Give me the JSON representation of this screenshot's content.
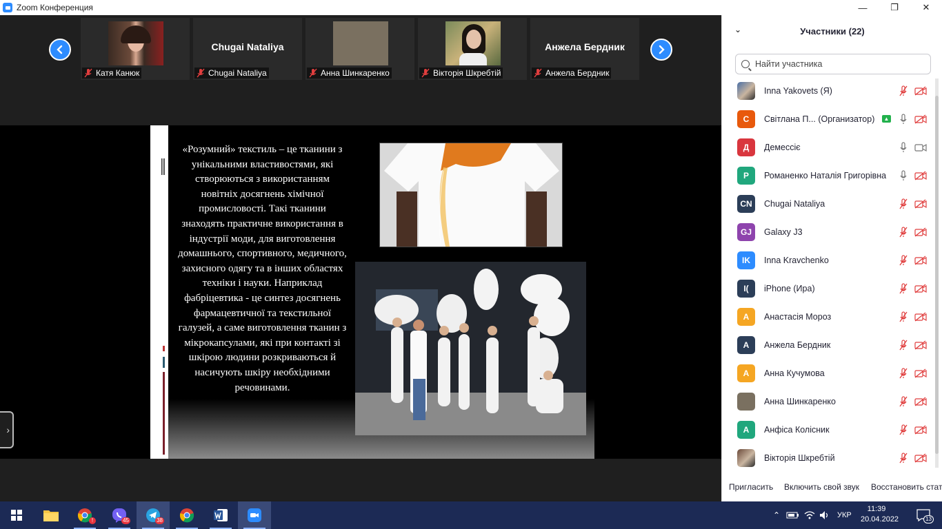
{
  "window": {
    "title": "Zoom Конференция"
  },
  "thumbnails": [
    {
      "name": "Катя Канюк",
      "has_photo": true
    },
    {
      "name": "Chugai Nataliya",
      "big_name": "Chugai Nataliya",
      "has_photo": false
    },
    {
      "name": "Анна Шинкаренко",
      "has_photo": true
    },
    {
      "name": "Вікторія Шкребтій",
      "has_photo": true
    },
    {
      "name": "Анжела Бердник",
      "big_name": "Анжела Бердник",
      "has_photo": false
    }
  ],
  "slide": {
    "text": "«Розумний» текстиль – це тканини з унікальними властивостями, які створюються з використанням новітніх досягнень хімічної промисловості. Такі тканини знаходять практичне використання в індустрії моди, для виготовлення домашнього, спортивного, медичного, захисного одягу та в інших областях техніки і науки. Наприклад фабріцевтика - це синтез досягнень фармацевтичної та текстильної галузей, а саме виготовлення тканин з мікрокапсулами, які при контакті зі шкірою людини розкриваються й насичують шкіру необхідними речовинами."
  },
  "participants_panel": {
    "title": "Участники (22)",
    "search_placeholder": "Найти участника",
    "participants": [
      {
        "name": "Inna Yakovets  (Я)",
        "initials": "",
        "color": "#4a6fa5",
        "photo": true,
        "mic": "muted",
        "cam": "off"
      },
      {
        "name": "Світлана П...   (Организатор)",
        "initials": "С",
        "color": "#e8590c",
        "photo": false,
        "mic": "on",
        "cam": "off",
        "share_badge": true
      },
      {
        "name": "Демессіє",
        "initials": "Д",
        "color": "#d9363e",
        "photo": false,
        "mic": "on",
        "cam": "on"
      },
      {
        "name": "Романенко Наталія Григорівна",
        "initials": "Р",
        "color": "#20a77d",
        "photo": false,
        "mic": "on",
        "cam": "off"
      },
      {
        "name": "Chugai Nataliya",
        "initials": "CN",
        "color": "#2c3e58",
        "photo": false,
        "mic": "muted",
        "cam": "off"
      },
      {
        "name": "Galaxy J3",
        "initials": "GJ",
        "color": "#8e44ad",
        "photo": false,
        "mic": "muted",
        "cam": "off"
      },
      {
        "name": "Inna Kravchenko",
        "initials": "IK",
        "color": "#2d8cff",
        "photo": false,
        "mic": "muted",
        "cam": "off"
      },
      {
        "name": "iPhone (Ира)",
        "initials": "I(",
        "color": "#2c3e58",
        "photo": false,
        "mic": "muted",
        "cam": "off"
      },
      {
        "name": "Анастасія Мороз",
        "initials": "А",
        "color": "#f5a623",
        "photo": false,
        "mic": "muted",
        "cam": "off"
      },
      {
        "name": "Анжела Бердник",
        "initials": "А",
        "color": "#2c3e58",
        "photo": false,
        "mic": "muted",
        "cam": "off"
      },
      {
        "name": "Анна Кучумова",
        "initials": "А",
        "color": "#f5a623",
        "photo": false,
        "mic": "muted",
        "cam": "off"
      },
      {
        "name": "Анна Шинкаренко",
        "initials": "",
        "color": "#7a7060",
        "photo": false,
        "mic": "muted",
        "cam": "off"
      },
      {
        "name": "Анфіса Колісник",
        "initials": "А",
        "color": "#20a77d",
        "photo": false,
        "mic": "muted",
        "cam": "off"
      },
      {
        "name": "Вікторія Шкребтій",
        "initials": "",
        "color": "#6b4a3a",
        "photo": true,
        "mic": "muted",
        "cam": "off"
      }
    ],
    "footer": {
      "invite": "Пригласить",
      "unmute": "Включить свой звук",
      "restore": "Восстановить стату"
    }
  },
  "taskbar": {
    "apps": [
      {
        "icon": "windows-start-icon"
      },
      {
        "icon": "file-explorer-icon"
      },
      {
        "icon": "chrome-icon",
        "badge": "!"
      },
      {
        "icon": "viber-icon",
        "badge": "45"
      },
      {
        "icon": "telegram-icon",
        "badge": "38"
      },
      {
        "icon": "chrome-alt-icon"
      },
      {
        "icon": "word-icon"
      },
      {
        "icon": "zoom-icon"
      }
    ],
    "language": "УКР",
    "time": "11:39",
    "date": "20.04.2022",
    "notifications": "13"
  }
}
